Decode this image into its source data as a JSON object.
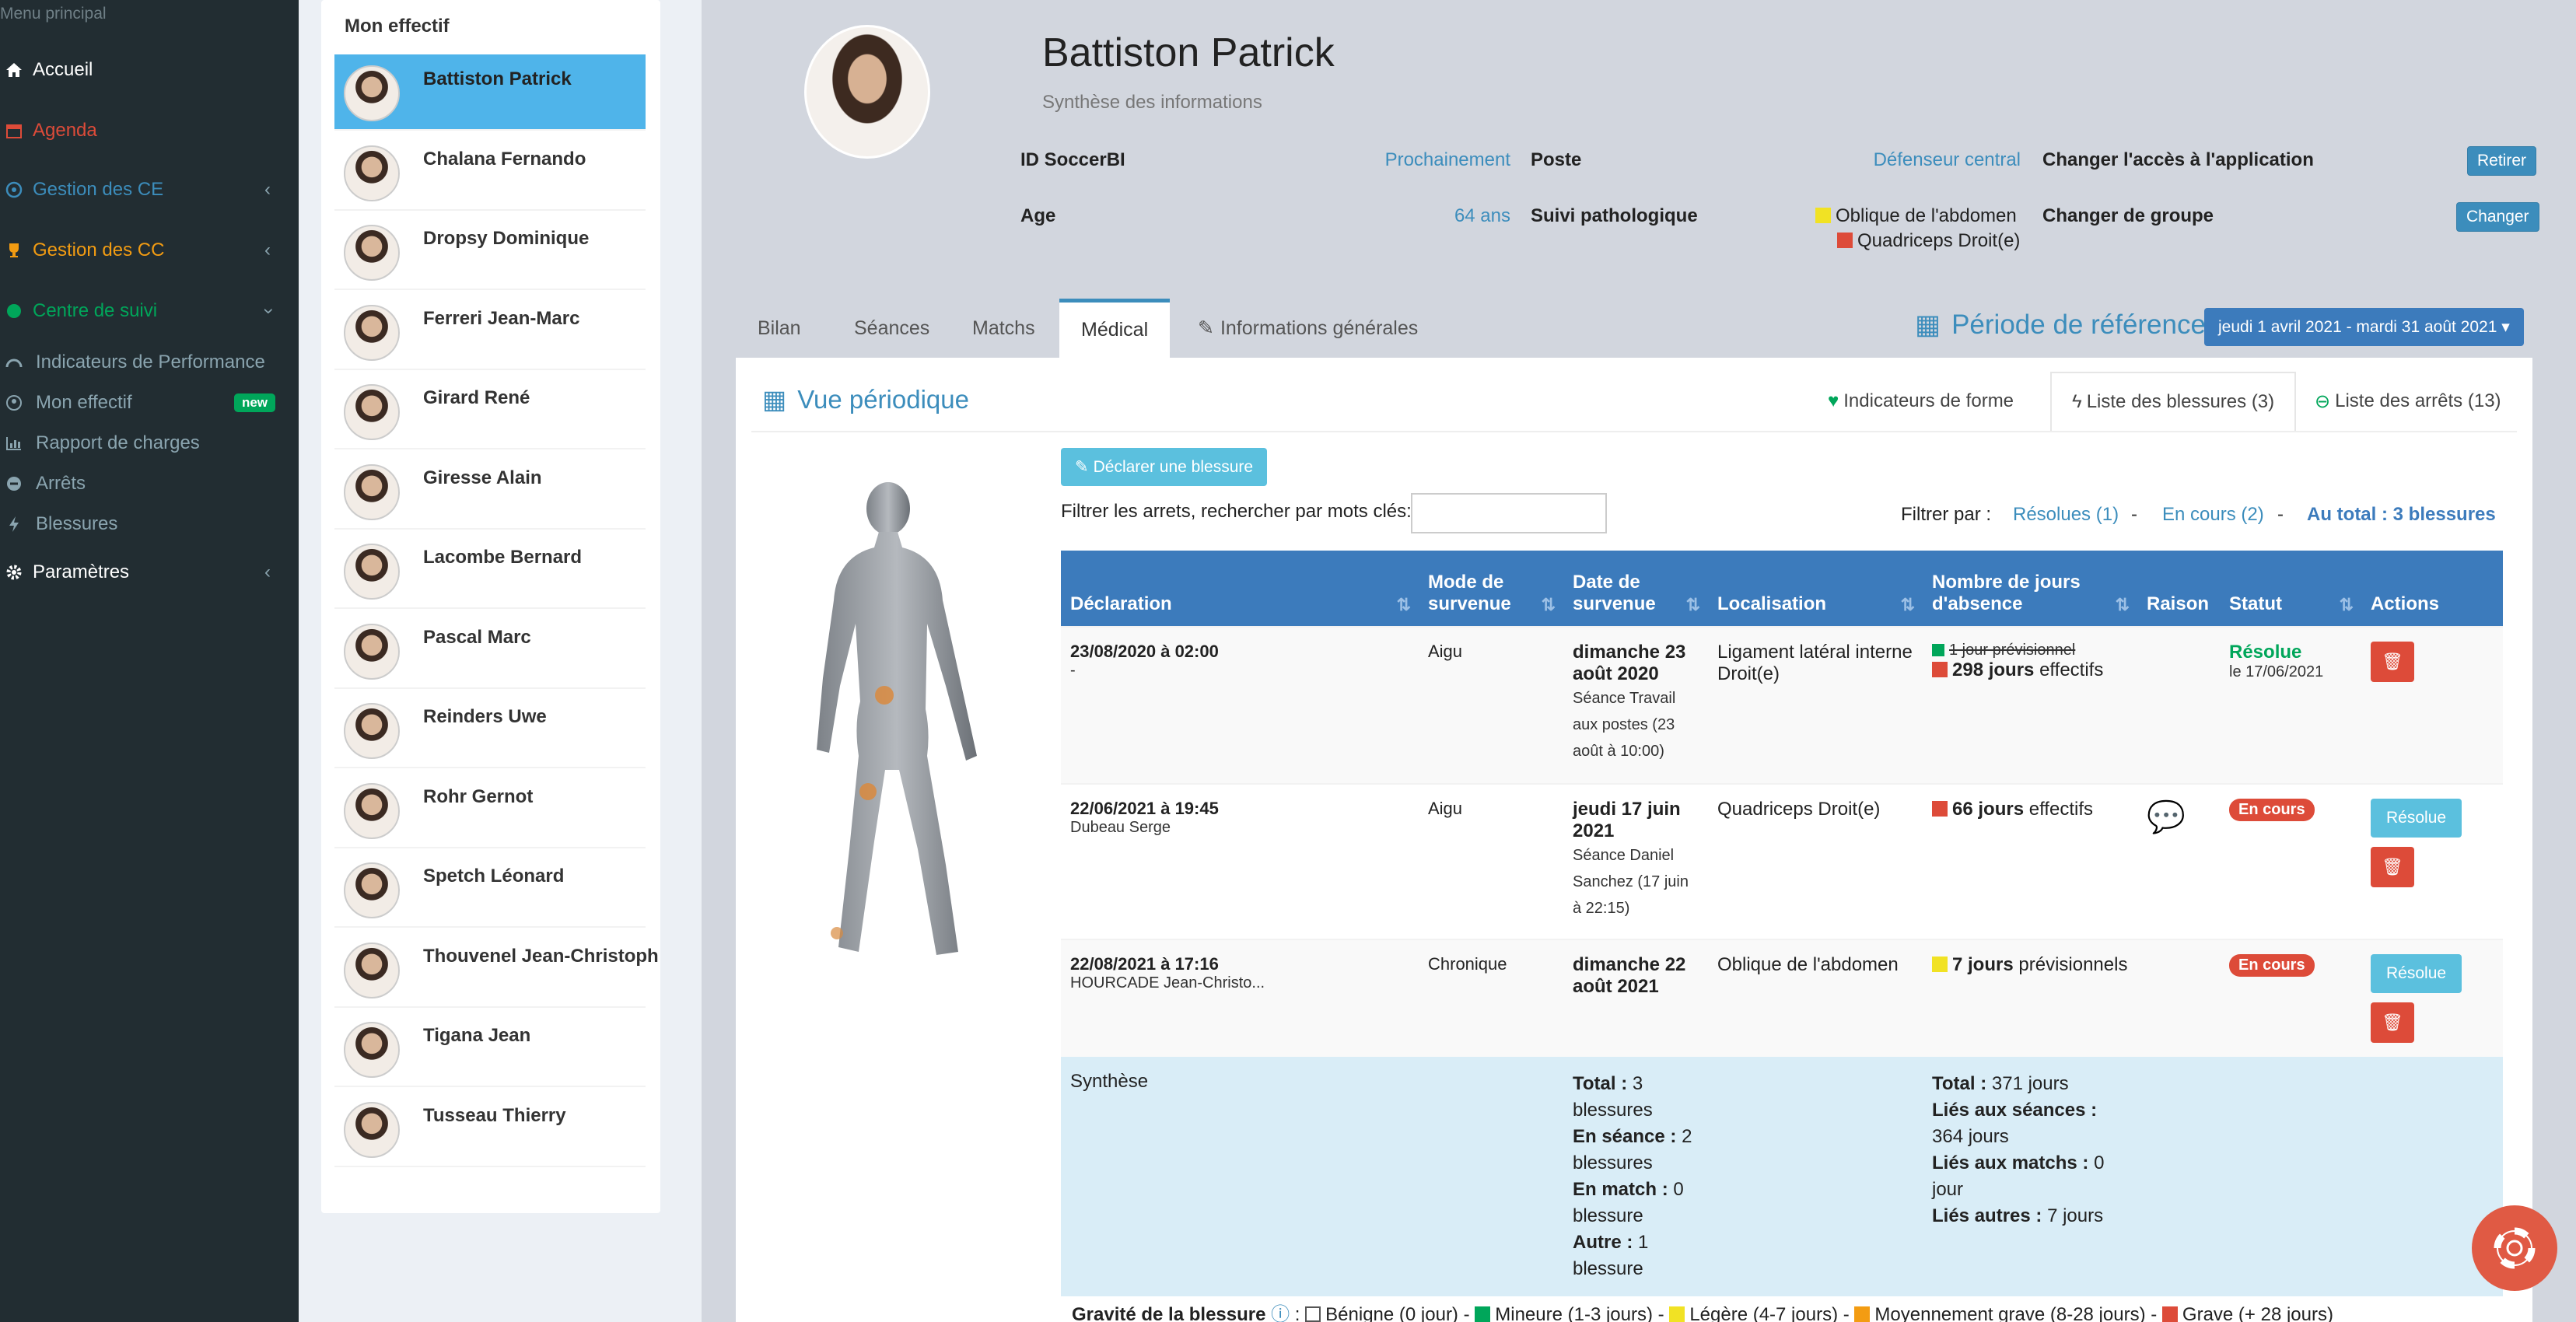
{
  "sidebar": {
    "header": "Menu principal",
    "items": [
      {
        "label": "Accueil",
        "color": "#ffffff"
      },
      {
        "label": "Agenda",
        "color": "#dd4b39"
      },
      {
        "label": "Gestion des CE",
        "color": "#3c8dbc"
      },
      {
        "label": "Gestion des CC",
        "color": "#f39c12"
      },
      {
        "label": "Centre de suivi",
        "color": "#00a65a"
      }
    ],
    "subitems": [
      {
        "label": "Indicateurs de Performance"
      },
      {
        "label": "Mon effectif",
        "badge": "new"
      },
      {
        "label": "Rapport de charges"
      },
      {
        "label": "Arrêts"
      },
      {
        "label": "Blessures"
      }
    ],
    "params": "Paramètres"
  },
  "roster": {
    "title": "Mon effectif",
    "players": [
      "Battiston Patrick",
      "Chalana Fernando",
      "Dropsy Dominique",
      "Ferreri Jean-Marc",
      "Girard René",
      "Giresse Alain",
      "Lacombe Bernard",
      "Pascal Marc",
      "Reinders Uwe",
      "Rohr Gernot",
      "Spetch Léonard",
      "Thouvenel Jean-Christoph",
      "Tigana Jean",
      "Tusseau Thierry"
    ]
  },
  "profile": {
    "name": "Battiston Patrick",
    "subtitle": "Synthèse des informations",
    "id_label": "ID SoccerBI",
    "id_value": "Prochainement",
    "age_label": "Age",
    "age_value": "64 ans",
    "poste_label": "Poste",
    "poste_value": "Défenseur central",
    "suivi_label": "Suivi pathologique",
    "suivi_1": "Oblique de l'abdomen",
    "suivi_2": "Quadriceps Droit(e)",
    "acces_label": "Changer l'accès à l'application",
    "acces_btn": "Retirer",
    "groupe_label": "Changer de groupe",
    "groupe_btn": "Changer"
  },
  "tabs": [
    "Bilan",
    "Séances",
    "Matchs",
    "Médical",
    "Informations générales"
  ],
  "periode": {
    "label": "Période de référence",
    "range": "jeudi 1 avril 2021 - mardi 31 août 2021"
  },
  "panel": {
    "title": "Vue périodique",
    "subtabs": [
      "Indicateurs de forme",
      "Liste des blessures (3)",
      "Liste des arrêts (13)"
    ],
    "declare_btn": "Déclarer une blessure",
    "filter_label": "Filtrer les arrets, rechercher par mots clés:",
    "filter_by": "Filtrer par :",
    "f_resolues": "Résolues (1)",
    "f_encours": "En cours (2)",
    "f_total": "Au total : 3 blessures"
  },
  "table": {
    "headers": [
      "Déclaration",
      "Mode de survenue",
      "Date de survenue",
      "Localisation",
      "Nombre de jours d'absence",
      "Raison",
      "Statut",
      "Actions"
    ],
    "rows": [
      {
        "decl": "23/08/2020 à 02:00",
        "decl_by": "-",
        "mode": "Aigu",
        "date": "dimanche 23 août 2020",
        "date_sub": "Séance Travail aux postes (23 août à 10:00)",
        "loc": "Ligament latéral interne Droit(e)",
        "prev": "1 jour prévisionnel",
        "eff_num": "298 jours",
        "eff_txt": "effectifs",
        "statut": "Résolue",
        "statut_date": "le 17/06/2021"
      },
      {
        "decl": "22/06/2021 à 19:45",
        "decl_by": "Dubeau Serge",
        "mode": "Aigu",
        "date": "jeudi 17 juin 2021",
        "date_sub": "Séance Daniel Sanchez (17 juin à 22:15)",
        "loc": "Quadriceps Droit(e)",
        "eff_num": "66 jours",
        "eff_txt": "effectifs",
        "statut": "En cours",
        "btn": "Résolue"
      },
      {
        "decl": "22/08/2021 à 17:16",
        "decl_by": "HOURCADE Jean-Christo...",
        "mode": "Chronique",
        "date": "dimanche 22 août 2021",
        "loc": "Oblique de l'abdomen",
        "eff_num": "7 jours",
        "eff_txt": "prévisionnels",
        "statut": "En cours",
        "btn": "Résolue"
      }
    ],
    "synth": {
      "label": "Synthèse",
      "total_l": "Total :",
      "total_v": "3 blessures",
      "seance_l": "En séance :",
      "seance_v": "2 blessures",
      "match_l": "En match :",
      "match_v": "0 blessure",
      "autre_l": "Autre :",
      "autre_v": "1 blessure",
      "jtotal_l": "Total :",
      "jtotal_v": "371 jours",
      "jseance_l": "Liés aux séances :",
      "jseance_v": "364 jours",
      "jmatch_l": "Liés aux matchs :",
      "jmatch_v": "0 jour",
      "jautre_l": "Liés autres :",
      "jautre_v": "7 jours"
    }
  },
  "gravite": {
    "label": "Gravité de la blessure",
    "items": [
      "Bénigne (0 jour)",
      "Mineure (1-3 jours)",
      "Légère (4-7 jours)",
      "Moyennement grave (8-28 jours)",
      "Grave (+ 28 jours)"
    ]
  },
  "colors": {
    "sidebar": "#222d32",
    "accent": "#3c8dbc",
    "danger": "#dd4b39",
    "success": "#00a65a",
    "warning": "#f39c12",
    "info": "#5bc0de"
  }
}
